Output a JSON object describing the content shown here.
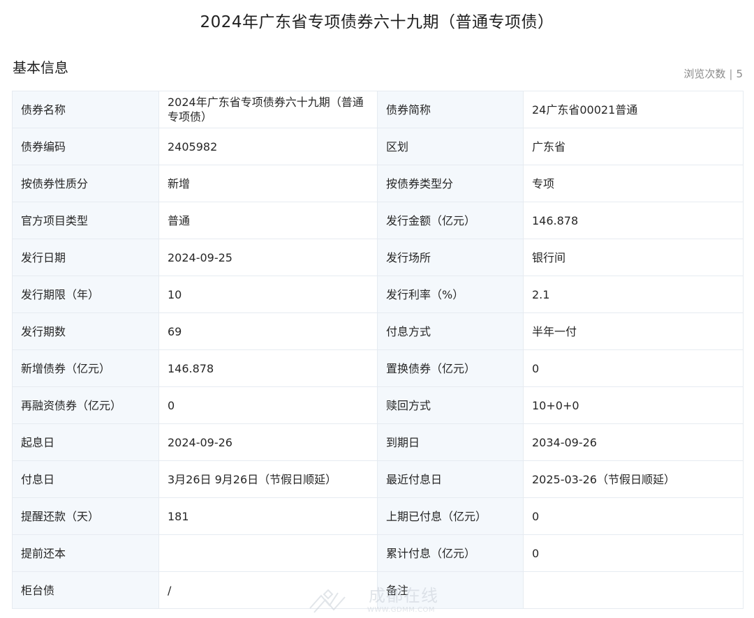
{
  "page": {
    "title": "2024年广东省专项债券六十九期（普通专项债）"
  },
  "section": {
    "title": "基本信息",
    "views_label": "浏览次数",
    "views_separator": "|",
    "views_count": "5"
  },
  "rows": [
    {
      "l1": "债券名称",
      "v1": "2024年广东省专项债券六十九期（普通专项债）",
      "l2": "债券简称",
      "v2": "24广东省00021普通"
    },
    {
      "l1": "债券编码",
      "v1": "2405982",
      "l2": "区划",
      "v2": "广东省"
    },
    {
      "l1": "按债券性质分",
      "v1": "新增",
      "l2": "按债券类型分",
      "v2": "专项"
    },
    {
      "l1": "官方项目类型",
      "v1": "普通",
      "l2": "发行金额（亿元）",
      "v2": "146.878"
    },
    {
      "l1": "发行日期",
      "v1": "2024-09-25",
      "l2": "发行场所",
      "v2": "银行间"
    },
    {
      "l1": "发行期限（年）",
      "v1": "10",
      "l2": "发行利率（%）",
      "v2": "2.1"
    },
    {
      "l1": "发行期数",
      "v1": "69",
      "l2": "付息方式",
      "v2": "半年一付"
    },
    {
      "l1": "新增债券（亿元）",
      "v1": "146.878",
      "l2": "置换债券（亿元）",
      "v2": "0"
    },
    {
      "l1": "再融资债券（亿元）",
      "v1": "0",
      "l2": "赎回方式",
      "v2": "10+0+0"
    },
    {
      "l1": "起息日",
      "v1": "2024-09-26",
      "l2": "到期日",
      "v2": "2034-09-26"
    },
    {
      "l1": "付息日",
      "v1": "3月26日 9月26日（节假日顺延）",
      "l2": "最近付息日",
      "v2": "2025-03-26（节假日顺延）"
    },
    {
      "l1": "提醒还款（天）",
      "v1": "181",
      "l2": "上期已付息（亿元）",
      "v2": "0"
    },
    {
      "l1": "提前还本",
      "v1": "",
      "l2": "累计付息（亿元）",
      "v2": "0"
    },
    {
      "l1": "柜台债",
      "v1": "/",
      "l2": "备注",
      "v2": ""
    }
  ],
  "watermark": {
    "text": "成都在线",
    "url": "WWW.GDMM.COM"
  },
  "colors": {
    "label_bg": "#f4f8fc",
    "border": "#e6ebf1",
    "muted_text": "#8a8a8a"
  }
}
